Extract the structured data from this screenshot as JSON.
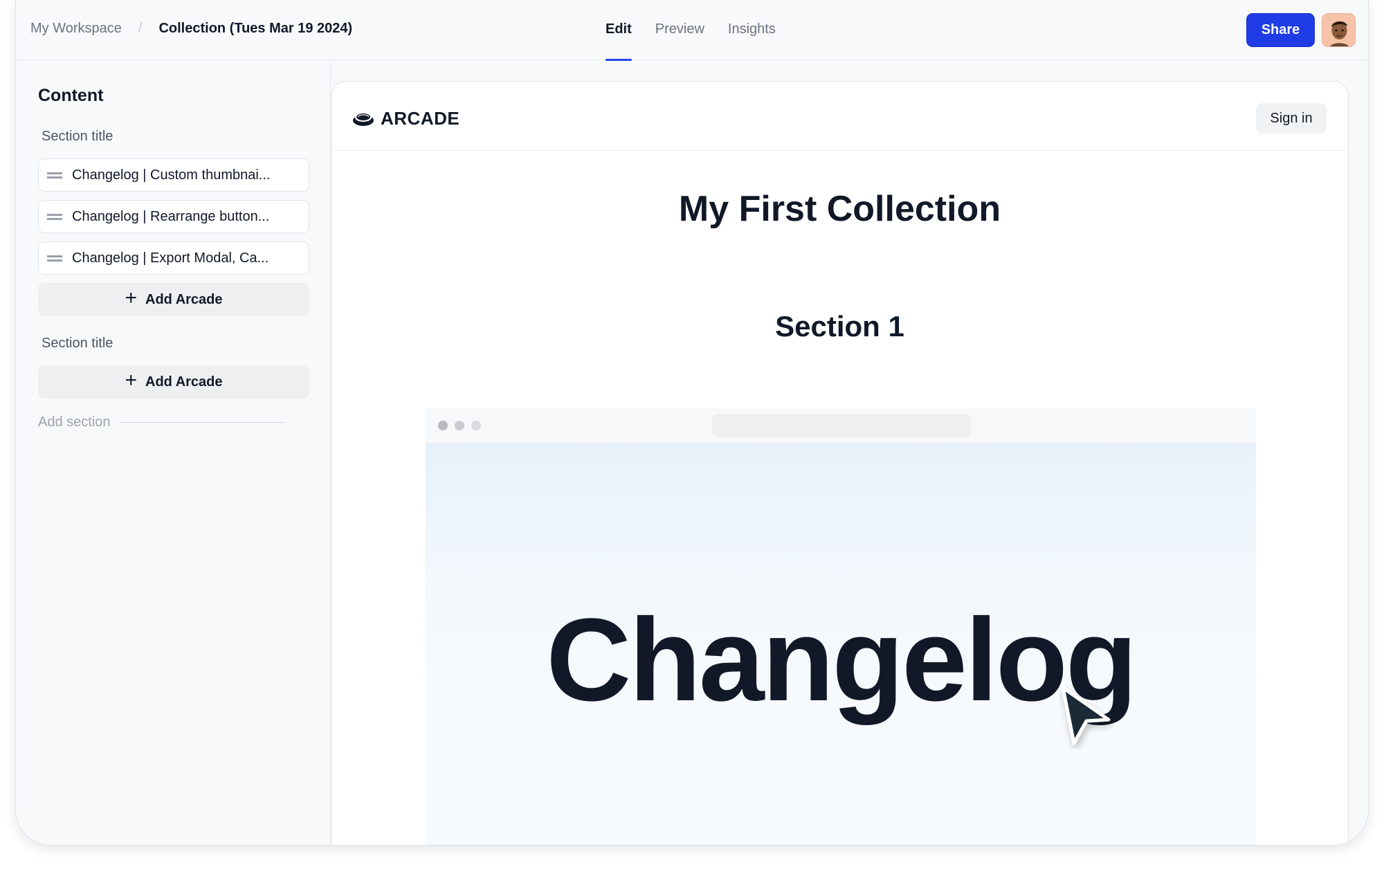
{
  "breadcrumb": {
    "workspace": "My Workspace",
    "separator": "/",
    "current": "Collection (Tues Mar 19 2024)"
  },
  "tabs": [
    {
      "label": "Edit",
      "active": true
    },
    {
      "label": "Preview",
      "active": false
    },
    {
      "label": "Insights",
      "active": false
    }
  ],
  "header": {
    "share_label": "Share",
    "avatar_icon": "user-avatar-icon"
  },
  "sidebar": {
    "heading": "Content",
    "sections": [
      {
        "title": "Section title",
        "items": [
          "Changelog | Custom thumbnai...",
          "Changelog | Rearrange button...",
          "Changelog | Export Modal, Ca..."
        ],
        "add_label": "Add Arcade"
      },
      {
        "title": "Section title",
        "items": [],
        "add_label": "Add Arcade"
      }
    ],
    "add_section_label": "Add section"
  },
  "preview": {
    "logo_text": "ARCADE",
    "sign_in_label": "Sign in",
    "collection_title": "My First Collection",
    "section_heading": "Section 1",
    "embed": {
      "headline": "Changelog"
    }
  },
  "colors": {
    "accent": "#1f3ce6",
    "text_primary": "#111827",
    "text_muted": "#6b7280",
    "window_dot_1": "#b6b9be",
    "window_dot_2": "#c9ccd0",
    "window_dot_3": "#d9dbde"
  }
}
